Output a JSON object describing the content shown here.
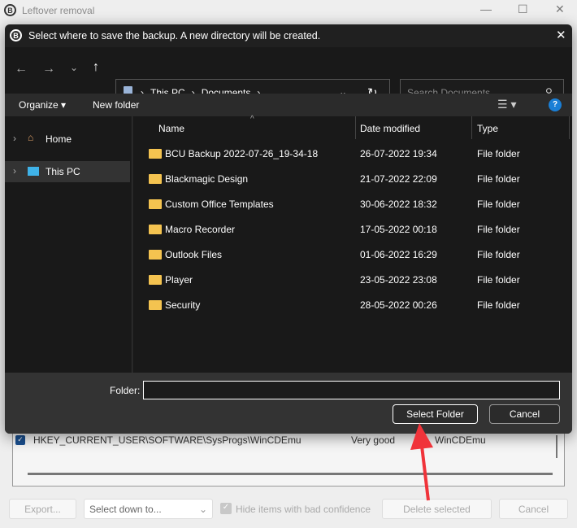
{
  "window": {
    "title": "Leftover removal",
    "logo": "B"
  },
  "background": {
    "row": {
      "key": "HKEY_CURRENT_USER\\SOFTWARE\\SysProgs\\WinCDEmu",
      "confidence": "Very good",
      "name": "WinCDEmu",
      "checked": true
    },
    "buttons": {
      "export": "Export...",
      "select_down": "Select down to...",
      "hide_bad": "Hide items with bad confidence",
      "delete": "Delete selected",
      "cancel": "Cancel"
    }
  },
  "dialog": {
    "title": "Select where to save the backup. A new directory will be created.",
    "breadcrumb": [
      "This PC",
      "Documents"
    ],
    "search_placeholder": "Search Documents",
    "toolbar": {
      "organize": "Organize",
      "new_folder": "New folder"
    },
    "sidebar": [
      {
        "label": "Home",
        "icon": "home-icon"
      },
      {
        "label": "This PC",
        "icon": "computer-icon",
        "selected": true
      }
    ],
    "columns": {
      "name": "Name",
      "date": "Date modified",
      "type": "Type"
    },
    "files": [
      {
        "name": "BCU Backup 2022-07-26_19-34-18",
        "date": "26-07-2022 19:34",
        "type": "File folder"
      },
      {
        "name": "Blackmagic Design",
        "date": "21-07-2022 22:09",
        "type": "File folder"
      },
      {
        "name": "Custom Office Templates",
        "date": "30-06-2022 18:32",
        "type": "File folder"
      },
      {
        "name": "Macro Recorder",
        "date": "17-05-2022 00:18",
        "type": "File folder"
      },
      {
        "name": "Outlook Files",
        "date": "01-06-2022 16:29",
        "type": "File folder"
      },
      {
        "name": "Player",
        "date": "23-05-2022 23:08",
        "type": "File folder"
      },
      {
        "name": "Security",
        "date": "28-05-2022 00:26",
        "type": "File folder"
      }
    ],
    "folder_label": "Folder:",
    "folder_value": "",
    "select_button": "Select Folder",
    "cancel_button": "Cancel"
  },
  "annotation": {
    "arrow_color": "#f0333a"
  },
  "colors": {
    "accent": "#1a7fd6",
    "folder": "#f4c350"
  }
}
